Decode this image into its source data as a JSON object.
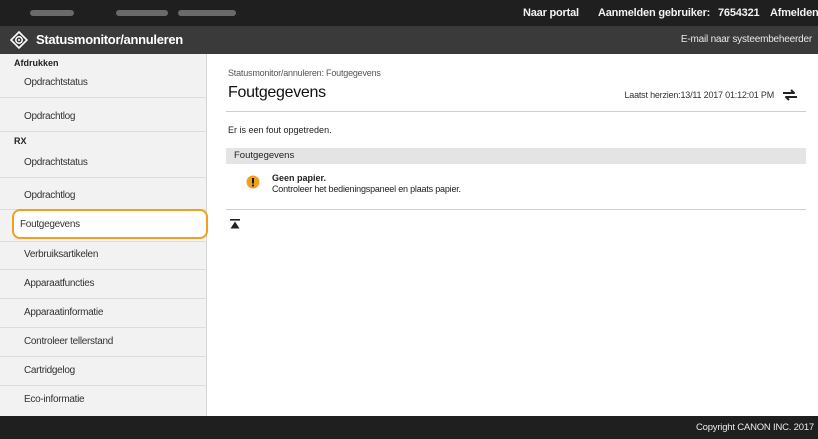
{
  "topbar": {
    "portal_link": "Naar portal",
    "user_label": "Aanmelden gebruiker:",
    "user_id": "7654321",
    "logout": "Afmelden"
  },
  "header": {
    "title": "Statusmonitor/annuleren",
    "email_link": "E-mail naar systeembeheerder"
  },
  "sidebar": {
    "section_print": "Afdrukken",
    "print_items": [
      "Opdrachtstatus",
      "Opdrachtlog"
    ],
    "section_fax": "RX",
    "fax_items": [
      "Opdrachtstatus",
      "Opdrachtlog"
    ],
    "active_item": "Foutgegevens",
    "other_items": [
      "Verbruiksartikelen",
      "Apparaatfuncties",
      "Apparaatinformatie",
      "Controleer tellerstand",
      "Cartridgelog",
      "Eco-informatie"
    ]
  },
  "main": {
    "breadcrumb": "Statusmonitor/annuleren: Foutgegevens",
    "title": "Foutgegevens",
    "last_updated": "Laatst herzien:13/11 2017 01:12:01 PM",
    "message": "Er is een fout opgetreden.",
    "section_title": "Foutgegevens",
    "error_title": "Geen papier.",
    "error_desc": "Controleer het bedieningspaneel en plaats papier."
  },
  "footer": {
    "copyright": "Copyright CANON INC. 2017"
  },
  "colors": {
    "topbar": "#1f1f1f",
    "titlebar": "#3a3a3a",
    "active_outline": "#f0a020",
    "warning": "#f0a020"
  }
}
